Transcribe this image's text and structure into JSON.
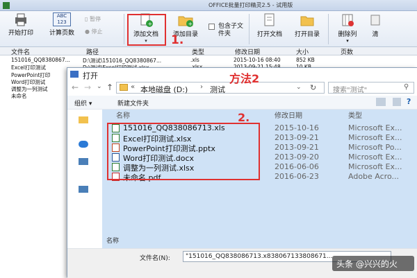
{
  "app": {
    "title": "OFFICE批量打印精灵2.5 - 试用版"
  },
  "toolbar": {
    "start_print": "开始打印",
    "calc_pages": "计算页数",
    "pause": "暂停",
    "stop": "停止",
    "add_doc": "添加文档",
    "add_dir": "添加目录",
    "include_subdir": "包含子文件夹",
    "open_doc": "打开文档",
    "open_dir": "打开目录",
    "delete_col": "删除列",
    "clear_partial": "清",
    "abc_text": "ABC",
    "num_text": "123"
  },
  "columns": {
    "filename": "文件名",
    "path": "路径",
    "type": "类型",
    "modified": "修改日期",
    "size": "大小",
    "pages": "页数"
  },
  "rows": [
    {
      "name": "151016_QQ8380867...",
      "path": "D:\\测试\\151016_QQ8380867...",
      "type": ".xls",
      "date": "2015-10-16 08:40",
      "size": "852 KB"
    },
    {
      "name": "Excel打印测试",
      "path": "D:\\测试\\Excel打印测试.xlsx",
      "type": ".xlsx",
      "date": "2013-09-21 15:48",
      "size": "10 KB"
    },
    {
      "name": "PowerPoint打印",
      "path": "",
      "type": "",
      "date": "",
      "size": ""
    },
    {
      "name": "Word打印测试",
      "path": "",
      "type": "",
      "date": "",
      "size": ""
    },
    {
      "name": "调整为一列测试",
      "path": "",
      "type": "",
      "date": "",
      "size": ""
    },
    {
      "name": "未命名",
      "path": "",
      "type": "",
      "date": "",
      "size": ""
    }
  ],
  "dialog": {
    "title": "打开",
    "breadcrumb_root": "本地磁盘 (D:)",
    "breadcrumb_folder": "测试",
    "search_placeholder": "搜索\"测试\"",
    "organize": "组织",
    "new_folder": "新建文件夹",
    "col_name": "名称",
    "col_date": "修改日期",
    "col_type": "类型",
    "files": [
      {
        "name": "151016_QQ838086713.xls",
        "date": "2015-10-16",
        "type": "Microsoft Ex...",
        "icon": "excel-icon"
      },
      {
        "name": "Excel打印测试.xlsx",
        "date": "2013-09-21",
        "type": "Microsoft Ex...",
        "icon": "excel-icon"
      },
      {
        "name": "PowerPoint打印测试.pptx",
        "date": "2013-09-21",
        "type": "Microsoft Po...",
        "icon": "powerpoint-icon"
      },
      {
        "name": "Word打印测试.docx",
        "date": "2013-09-20",
        "type": "Microsoft Ex...",
        "icon": "word-icon"
      },
      {
        "name": "调整为一列测试.xlsx",
        "date": "2016-06-06",
        "type": "Microsoft Ex...",
        "icon": "excel-icon"
      },
      {
        "name": "未命名.pdf",
        "date": "2016-06-23",
        "type": "Adobe Acro...",
        "icon": "pdf-icon"
      }
    ],
    "filename_label": "文件名(N):",
    "filename_value": "\"151016_QQ838086713.x838067133808671...",
    "bottom_col": "名称"
  },
  "annotations": {
    "step1": "1.",
    "method2": "方法2",
    "step2": "2."
  },
  "watermark": "头条 @兴兴的火",
  "colors": {
    "annotation_red": "#e03030",
    "selection_blue": "#cfe2f6",
    "excel_green": "#2e7d32"
  }
}
